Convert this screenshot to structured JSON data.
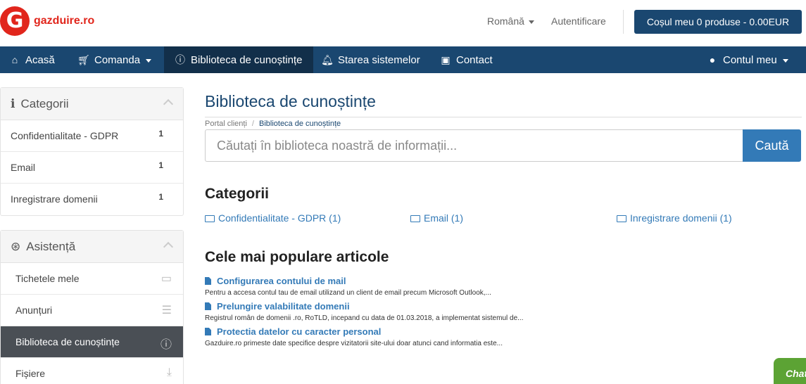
{
  "header": {
    "logo_letter": "G",
    "logo_text": "gazduire.ro",
    "language": "Română",
    "login": "Autentificare",
    "cart": "Coșul meu 0 produse - 0.00EUR"
  },
  "nav": {
    "items": [
      {
        "label": "Acasă",
        "icon": "home-icon"
      },
      {
        "label": "Comanda",
        "icon": "cart-icon"
      },
      {
        "label": "Biblioteca de cunoștințe",
        "icon": "info-icon"
      },
      {
        "label": "Starea sistemelor",
        "icon": "bell-icon"
      },
      {
        "label": "Contact",
        "icon": "contact-icon"
      }
    ],
    "account": "Contul meu"
  },
  "sidebar": {
    "categories": {
      "title": "Categorii",
      "items": [
        {
          "label": "Confidentialitate - GDPR",
          "count": "1"
        },
        {
          "label": "Email",
          "count": "1"
        },
        {
          "label": "Inregistrare domenii",
          "count": "1"
        }
      ]
    },
    "support": {
      "title": "Asistență",
      "items": [
        {
          "label": "Tichetele mele",
          "icon": "ticket-icon"
        },
        {
          "label": "Anunțuri",
          "icon": "list-icon"
        },
        {
          "label": "Biblioteca de cunoștințe",
          "icon": "info-icon"
        },
        {
          "label": "Fișiere",
          "icon": "download-icon"
        }
      ]
    }
  },
  "main": {
    "title": "Biblioteca de cunoștințe",
    "breadcrumb": [
      "Portal clienți",
      "Biblioteca de cunoștințe"
    ],
    "search_placeholder": "Căutați în biblioteca noastră de informații...",
    "search_button": "Caută",
    "categories_heading": "Categorii",
    "categories": [
      "Confidentialitate - GDPR (1)",
      "Email (1)",
      "Inregistrare domenii (1)"
    ],
    "popular_heading": "Cele mai populare articole",
    "articles": [
      {
        "title": "Configurarea contului de mail",
        "desc": "Pentru a accesa contul tau de email utilizand un client de email precum Microsoft Outlook,..."
      },
      {
        "title": "Prelungire valabilitate domenii",
        "desc": "Registrul român de domenii .ro, RoTLD, incepand cu data de 01.03.2018, a implementat sistemul de..."
      },
      {
        "title": "Protectia datelor cu caracter personal",
        "desc": "Gazduire.ro primeste date specifice despre vizitatorii site-ului doar atunci cand informatia este..."
      }
    ]
  },
  "chat": {
    "label": "Chat"
  }
}
